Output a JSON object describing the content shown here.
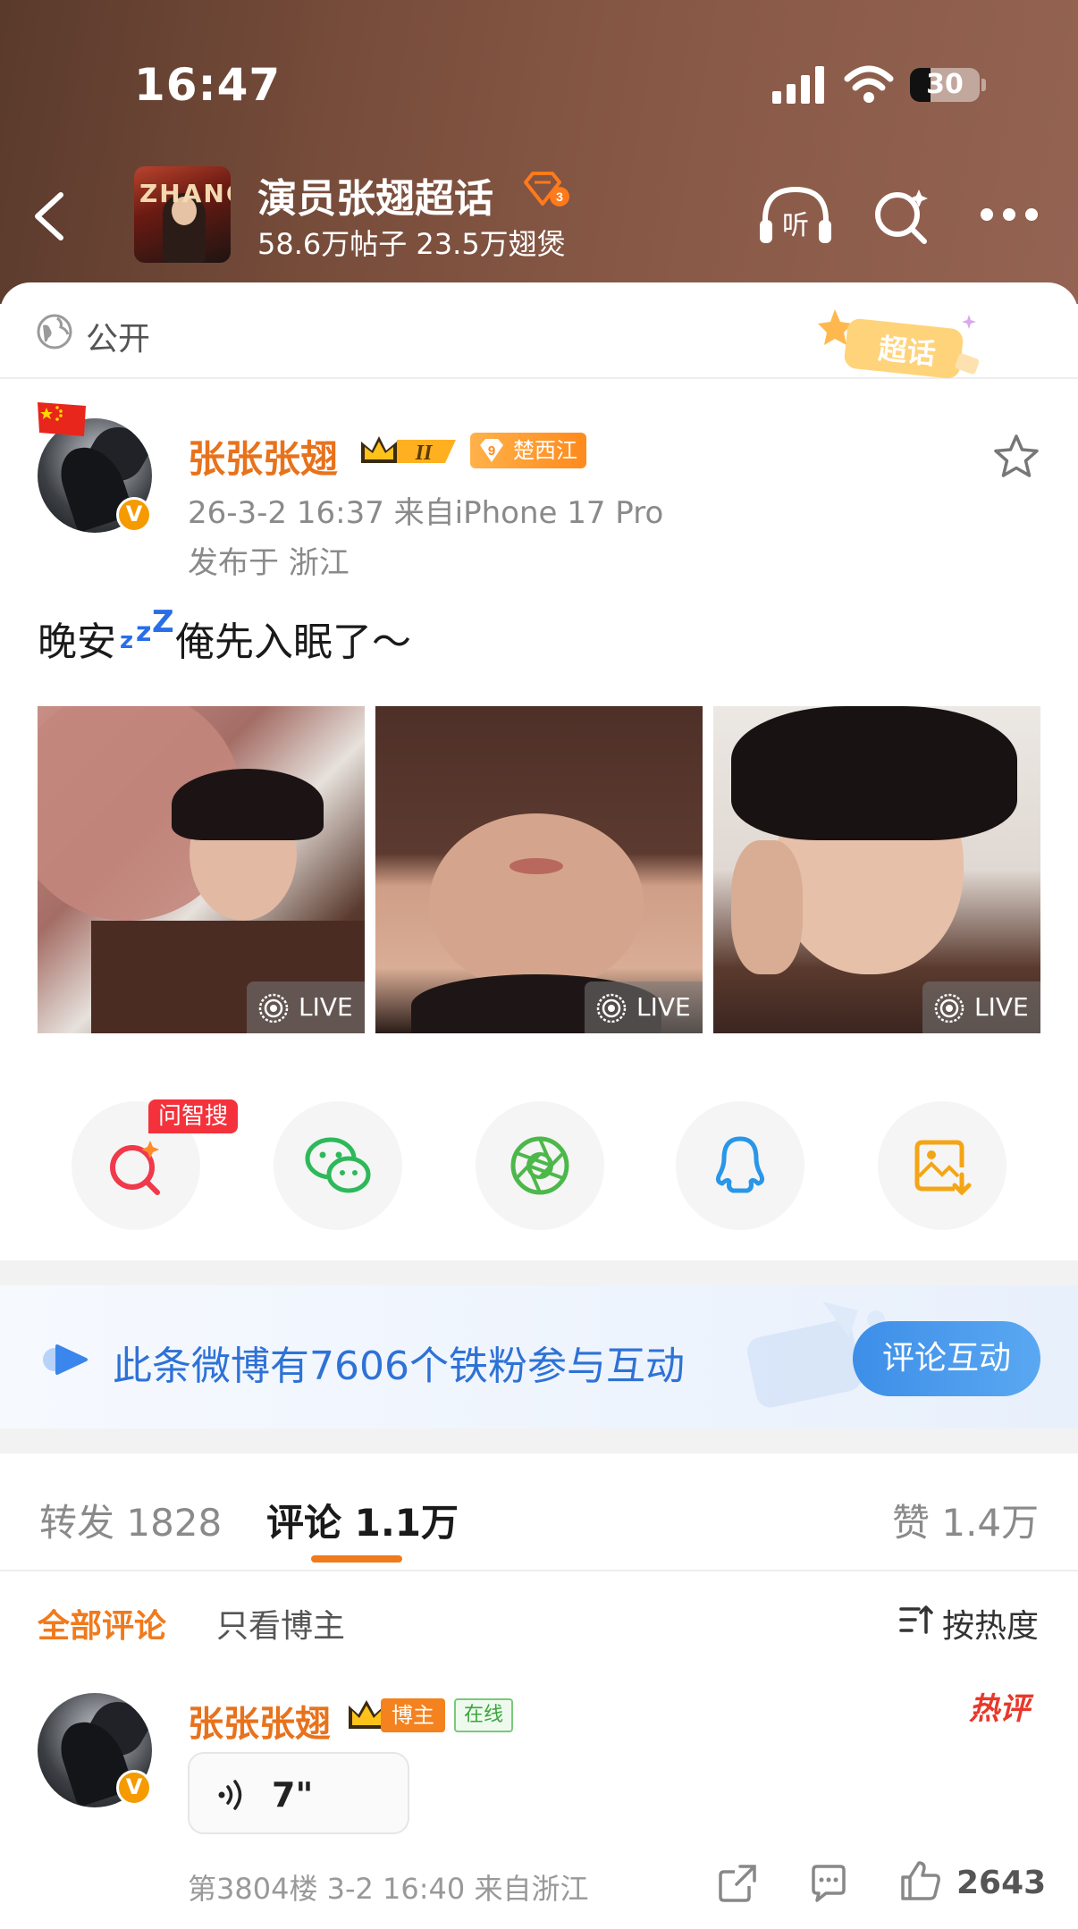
{
  "status_bar": {
    "time": "16:47",
    "battery": "30",
    "battery_level": 0.3
  },
  "nav": {
    "topic_title": "演员张翅超话",
    "topic_stats": "58.6万帖子 23.5万翅煲",
    "thumb_letters": "ZHANG"
  },
  "visibility": {
    "label": "公开",
    "stamp": "超话"
  },
  "post": {
    "author": "张张张翅",
    "crown_level": "II",
    "region_level": "9",
    "region_badge": "楚西江",
    "time_source": "26-3-2 16:37  来自iPhone 17 Pro",
    "location": "发布于 浙江",
    "text_before": "晚安",
    "zzz": [
      "z",
      "z",
      "Z"
    ],
    "text_after": "俺先入眠了～",
    "photos": [
      {
        "live": "LIVE"
      },
      {
        "live": "LIVE"
      },
      {
        "live": "LIVE"
      }
    ]
  },
  "share": {
    "ai_tag": "问智搜",
    "buttons": [
      "ai-search",
      "wechat",
      "moments",
      "qq",
      "save-image"
    ]
  },
  "fan_banner": {
    "text": "此条微博有7606个铁粉参与互动",
    "button": "评论互动"
  },
  "tabs": {
    "repost": "转发 1828",
    "comments": "评论 1.1万",
    "likes": "赞 1.4万"
  },
  "filters": {
    "all": "全部评论",
    "host_only": "只看博主",
    "sort": "按热度"
  },
  "comment": {
    "author": "张张张翅",
    "host_badge": "博主",
    "online_badge": "在线",
    "hot_tag": "热评",
    "voice_duration": "7\"",
    "meta": "第3804楼 3-2 16:40 来自浙江",
    "like_count": "2643"
  },
  "colors": {
    "accent_orange": "#e8721c",
    "link_blue": "#2e72d6",
    "hot_red": "#e8382b"
  }
}
